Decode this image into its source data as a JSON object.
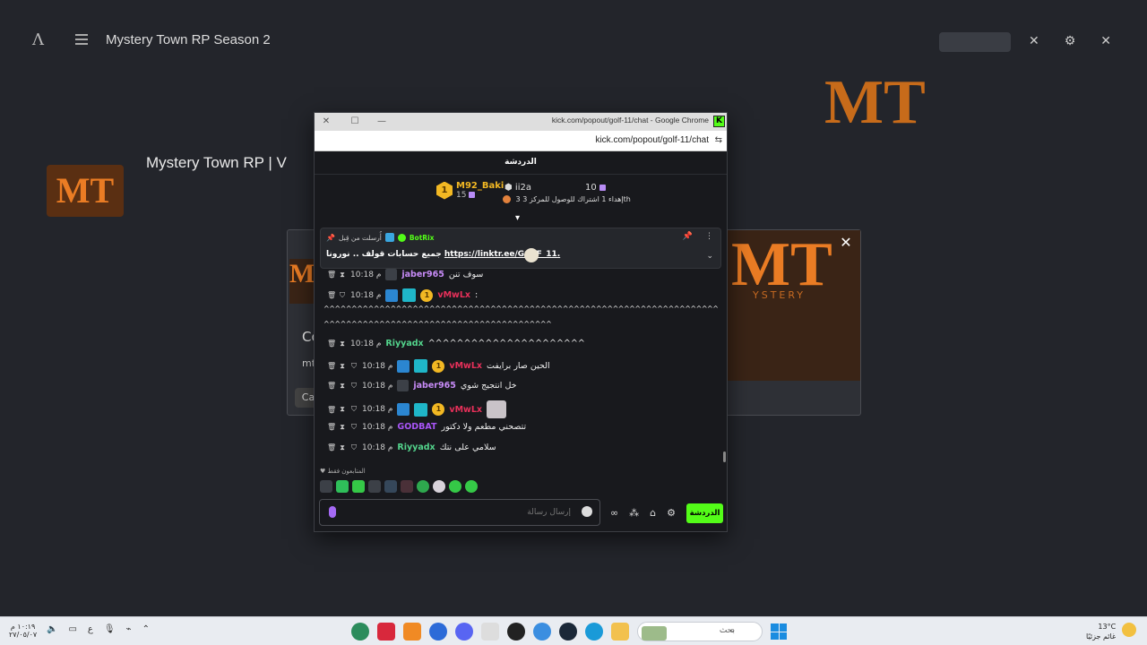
{
  "background": {
    "logo": "Λ",
    "title": "Mystery Town RP Season 2",
    "channel_title": "Mystery Town RP | V",
    "channel_logo": "MT",
    "banner": "MT"
  },
  "modal": {
    "heading": "Co",
    "sub": "mt",
    "cancel": "Ca",
    "art_text": "MT",
    "art_sub": "YSTERY",
    "close": "✕"
  },
  "window": {
    "title": "kick.com/popout/golf-11/chat - Google Chrome",
    "favicon": "K",
    "url": "kick.com/popout/golf-11/chat",
    "minimize": "—",
    "maximize": "☐",
    "close": "✕"
  },
  "chat": {
    "header": "الدردشة",
    "leaderboard": {
      "first": {
        "rank": "1",
        "name": "M92_Baki",
        "score": "15"
      },
      "second": {
        "name": "ii2a"
      },
      "third": {
        "score": "10"
      },
      "goal": "إهداء 1 اشتراك للوصول للمركز 3",
      "goal_suffix": "th",
      "goal_rank": "3"
    },
    "pinned": {
      "user": "BotRix",
      "meta": "أُرسلت من قِبل",
      "link": "https://linktr.ee/GOLF_11.",
      "text": "جميع حسابات قولف .. نورونا"
    },
    "messages": [
      {
        "time": "10:18 م",
        "user": "jaber965",
        "text": "سوف تنن",
        "color": "#c78bf7"
      },
      {
        "time": "10:18 م",
        "user": "vMwLx",
        "text": ":",
        "color": "#e8305a"
      },
      {
        "long1": "^^^^^^^^^^^^^^^^^^^^^^^^^^^^^^^^^^^^^^^^^^^^^^^^^^^^^^^^^^^^^^^^^^^^^^^^^^^^^^^^^^^^^^^^^^^^^^^^^^^^^^^^^^^^^^^^^^^^^^",
        "long2": "^^^^^^^^^^^^^^^^^^^^^^^^^^^^^^^^^^^^^^^^^"
      },
      {
        "time": "10:18 م",
        "user": "Riyyadx",
        "text": "^^^^^^^^^^^^^^^^^^^^^^",
        "color": "#53d48c"
      },
      {
        "time": "10:18 م",
        "user": "vMwLx",
        "text": "الحين صار برايفت",
        "color": "#e8305a"
      },
      {
        "time": "10:18 م",
        "user": "jaber965",
        "text": "خل انتجيج شوي",
        "color": "#c78bf7"
      },
      {
        "time": "10:18 م",
        "user": "vMwLx",
        "text": "",
        "color": "#e8305a"
      },
      {
        "time": "10:18 م",
        "user": "GODBAT",
        "text": "تتصحني مطعم ولا دكتور",
        "color": "#a855f7"
      },
      {
        "time": "10:18 م",
        "user": "Riyyadx",
        "text": "سلامي على نتك",
        "color": "#53d48c"
      }
    ],
    "gold_badge": "1",
    "emote_label": "المتابعون فقط",
    "composer_placeholder": "إرسال رسالة",
    "send_label": "الدردشة",
    "infinity": "∞"
  },
  "taskbar": {
    "time": "١٠:١٩ م",
    "date": "٢٧/٠٥/٠٧",
    "lang": "ع",
    "search_placeholder": "بحث",
    "weather_temp": "13°C",
    "weather_label": "غائم جزئيًا"
  },
  "colors": {
    "kick_green": "#53fc18",
    "accent_gold": "#f2b823"
  }
}
